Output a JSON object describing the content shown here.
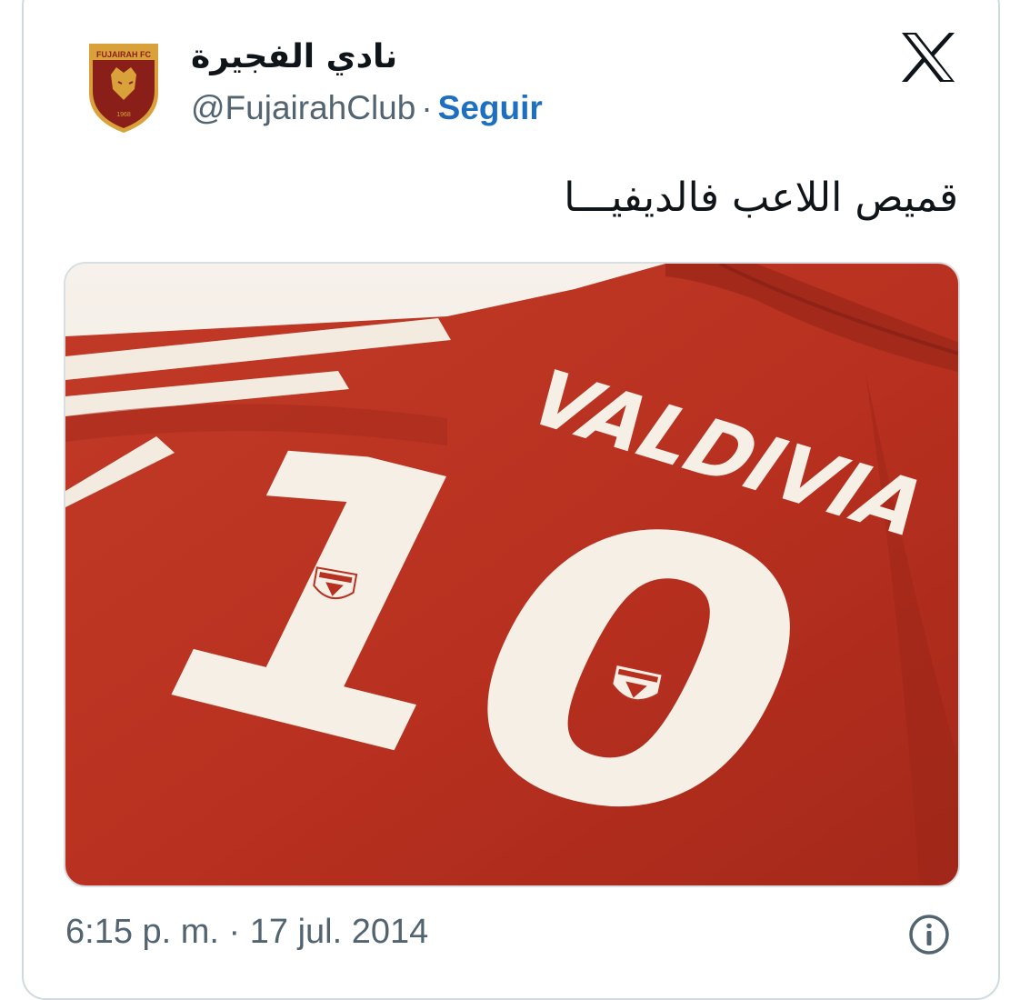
{
  "tweet": {
    "display_name": "نادي الفجيرة",
    "handle": "@FujairahClub",
    "separator": "·",
    "follow_label": "Seguir",
    "text": "قميص اللاعب فالديفيـــا",
    "timestamp": "6:15 p. m. · 17 jul. 2014"
  },
  "avatar": {
    "badge_text": "FUJAIRAH FC",
    "year": "1968",
    "icon": "crest-logo"
  },
  "media": {
    "jersey_name": "VALDIVIA",
    "jersey_number": "10",
    "shirt_color": "#b8301f",
    "print_color": "#f6efe6"
  },
  "icons": {
    "x": "x-logo-icon",
    "info": "info-icon"
  },
  "colors": {
    "follow": "#1d6fc1",
    "muted": "#536471",
    "text": "#0f1419",
    "border": "#cfd9de"
  }
}
